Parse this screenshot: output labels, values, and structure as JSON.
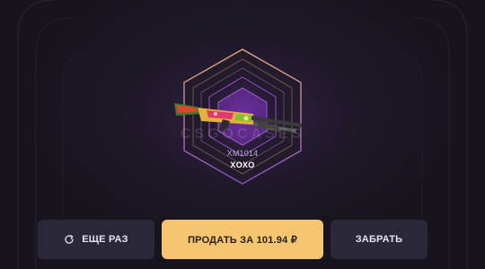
{
  "item": {
    "type": "XM1014",
    "name": "XOXO",
    "watermark": "CSGOCASES",
    "rarity_color": "#9b4dd6",
    "accent_color": "#e0a070"
  },
  "buttons": {
    "again_label": "ЕЩЕ РАЗ",
    "again_icon": "refresh-icon",
    "sell_label": "ПРОДАТЬ ЗА 101.94 ₽",
    "take_label": "ЗАБРАТЬ"
  },
  "colors": {
    "background": "#17141d",
    "sell_button": "#f5c572",
    "secondary_button": "#2a2838"
  }
}
